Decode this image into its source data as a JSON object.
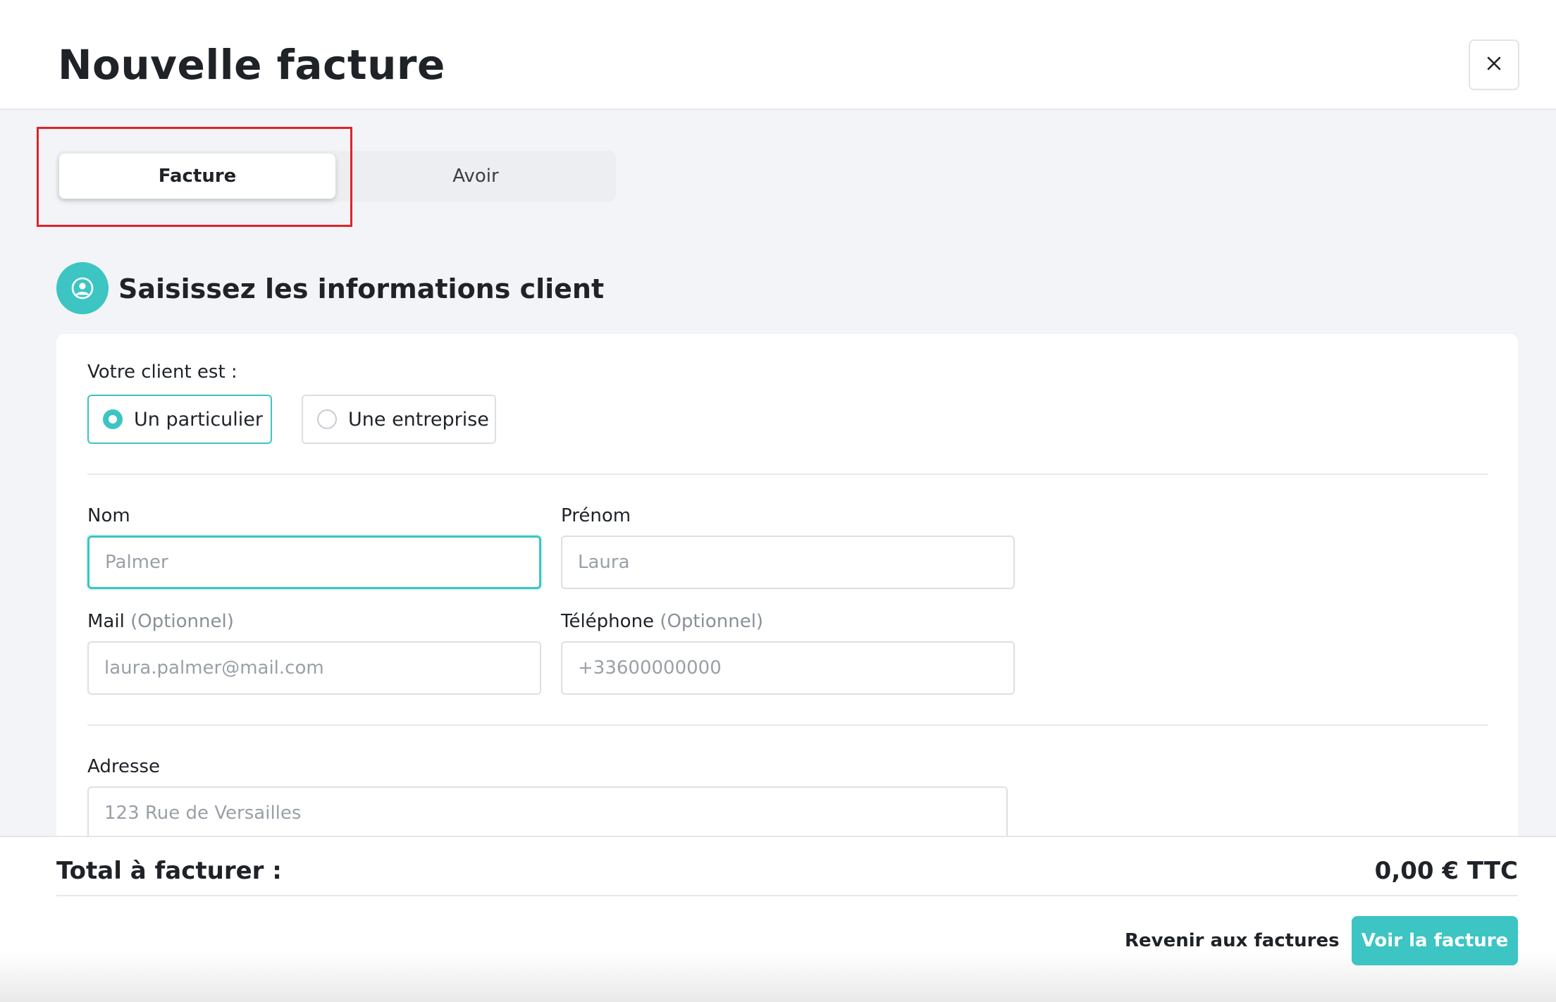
{
  "header": {
    "title": "Nouvelle facture",
    "close_icon": "close-icon"
  },
  "tabs": [
    {
      "label": "Facture",
      "active": true
    },
    {
      "label": "Avoir",
      "active": false
    }
  ],
  "section": {
    "icon": "user-circle-icon",
    "title": "Saisissez les informations client"
  },
  "client_type": {
    "label": "Votre client est :",
    "options": [
      {
        "label": "Un particulier",
        "selected": true
      },
      {
        "label": "Une entreprise",
        "selected": false
      }
    ]
  },
  "fields": {
    "nom": {
      "label": "Nom",
      "placeholder": "Palmer"
    },
    "prenom": {
      "label": "Prénom",
      "placeholder": "Laura"
    },
    "mail": {
      "label": "Mail",
      "optional": "(Optionnel)",
      "placeholder": "laura.palmer@mail.com"
    },
    "telephone": {
      "label": "Téléphone",
      "optional": "(Optionnel)",
      "placeholder": "+33600000000"
    },
    "adresse": {
      "label": "Adresse",
      "placeholder": "123 Rue de Versailles"
    }
  },
  "footer": {
    "total_label": "Total à facturer :",
    "total_value": "0,00 € TTC",
    "back_label": "Revenir aux factures",
    "primary_label": "Voir la facture"
  },
  "colors": {
    "accent": "#3cc5c3",
    "highlight": "#e0242b",
    "background": "#f3f4f7"
  }
}
